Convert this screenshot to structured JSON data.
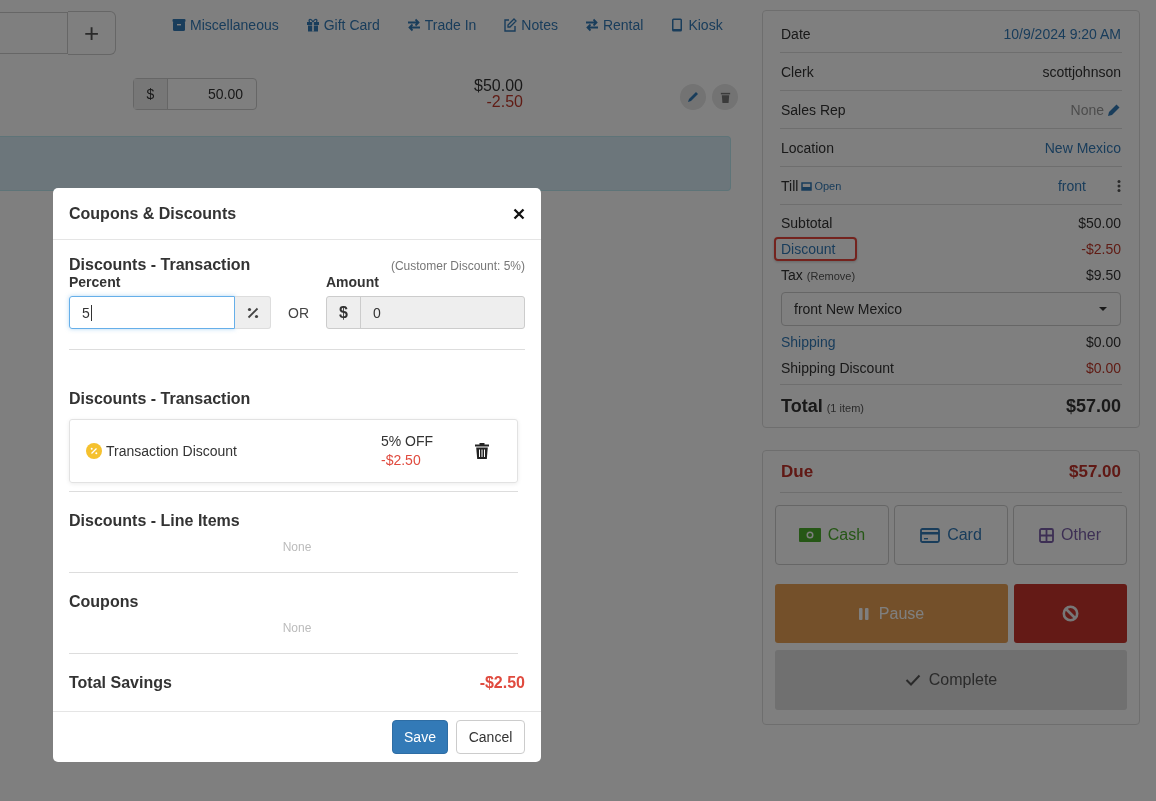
{
  "toolbar": {
    "add_button": "+",
    "links": [
      {
        "label": "Miscellaneous"
      },
      {
        "label": "Gift Card"
      },
      {
        "label": "Trade In"
      },
      {
        "label": "Notes"
      },
      {
        "label": "Rental"
      },
      {
        "label": "Kiosk"
      }
    ]
  },
  "line_item": {
    "currency": "$",
    "price": "50.00",
    "total": "$50.00",
    "discount": "-2.50"
  },
  "summary": {
    "info_rows": [
      {
        "label": "Date",
        "value": "10/9/2024 9:20 AM",
        "link": true,
        "editable": false
      },
      {
        "label": "Clerk",
        "value": "scottjohnson",
        "link": false,
        "editable": false
      },
      {
        "label": "Sales Rep",
        "value": "None",
        "link": false,
        "editable": true
      },
      {
        "label": "Location",
        "value": "New Mexico",
        "link": true,
        "editable": false
      }
    ],
    "till": {
      "label": "Till",
      "status": "Open",
      "value": "front"
    },
    "totals": [
      {
        "label": "Subtotal",
        "value": "$50.00",
        "link": false,
        "negative": false,
        "highlighted": false
      },
      {
        "label": "Discount",
        "value": "-$2.50",
        "link": true,
        "negative": true,
        "highlighted": true
      },
      {
        "label": "Tax",
        "note": "(Remove)",
        "value": "$9.50",
        "link": false,
        "negative": false,
        "highlighted": false
      }
    ],
    "tax_select": "front New Mexico",
    "shipping": [
      {
        "label": "Shipping",
        "value": "$0.00",
        "link": true,
        "negative": false,
        "highlighted": false
      },
      {
        "label": "Shipping Discount",
        "value": "$0.00",
        "link": false,
        "negative": true,
        "highlighted": false
      }
    ],
    "total": {
      "label": "Total",
      "note": "(1 item)",
      "value": "$57.00"
    }
  },
  "payment": {
    "due_label": "Due",
    "due_value": "$57.00",
    "methods": [
      {
        "label": "Cash",
        "kind": "cash"
      },
      {
        "label": "Card",
        "kind": "card"
      },
      {
        "label": "Other",
        "kind": "other"
      }
    ],
    "pause": "Pause",
    "complete": "Complete"
  },
  "modal": {
    "title": "Coupons & Discounts",
    "entry": {
      "heading": "Discounts - Transaction",
      "note": "(Customer Discount: 5%)",
      "percent_label": "Percent",
      "percent_value": "5",
      "or": "OR",
      "amount_label": "Amount",
      "amount_currency": "$",
      "amount_value": "0",
      "amount_disabled": true
    },
    "sections": [
      {
        "heading": "Discounts - Transaction",
        "items": [
          {
            "name": "Transaction Discount",
            "off": "5% OFF",
            "amount": "-$2.50"
          }
        ]
      },
      {
        "heading": "Discounts - Line Items",
        "empty_text": "None"
      },
      {
        "heading": "Coupons",
        "empty_text": "None"
      }
    ],
    "total_label": "Total Savings",
    "total_value": "-$2.50",
    "buttons": {
      "save": "Save",
      "cancel": "Cancel"
    }
  }
}
